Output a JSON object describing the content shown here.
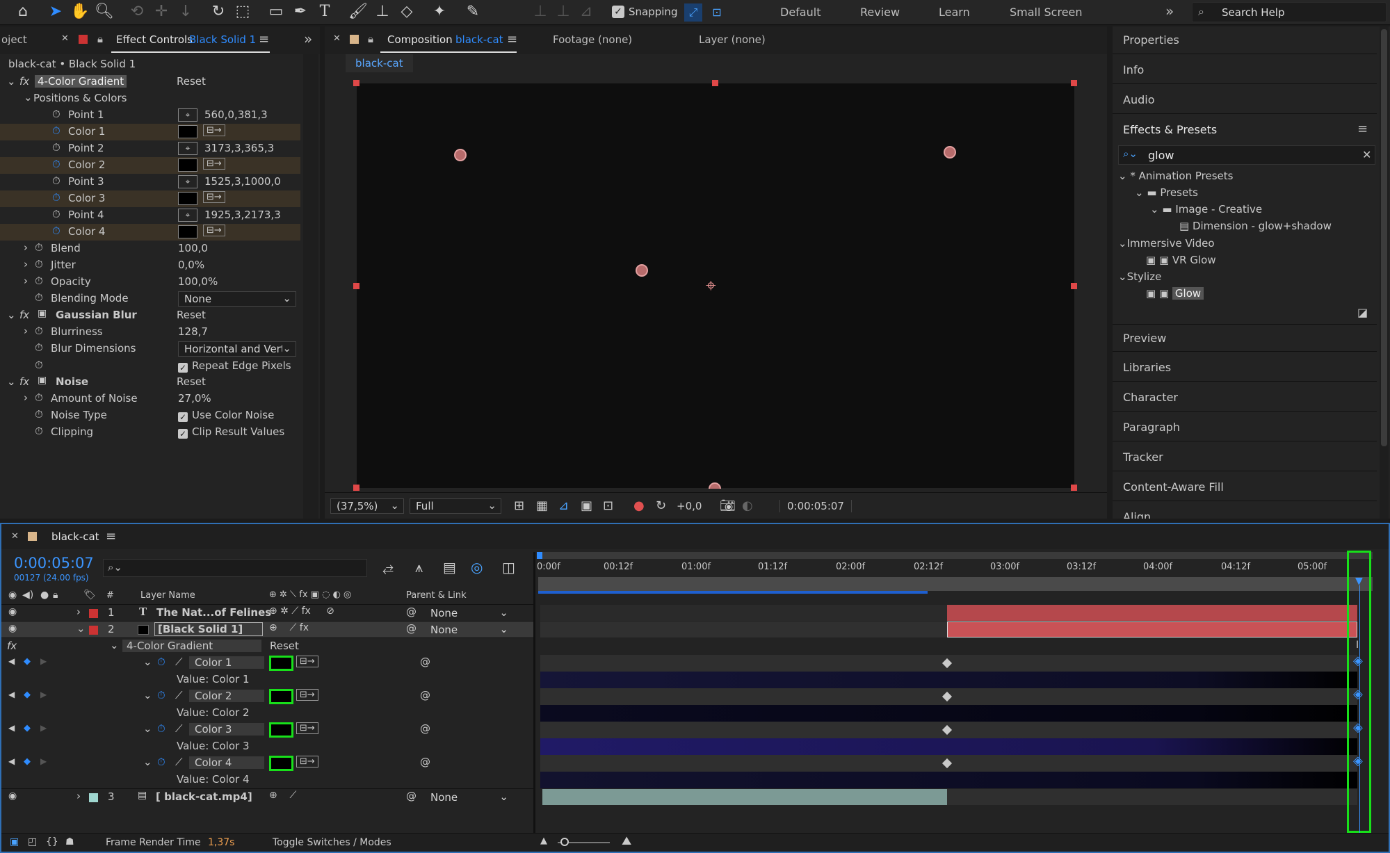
{
  "toolbar": {
    "snapping": "Snapping",
    "workspaces": [
      "Default",
      "Review",
      "Learn",
      "Small Screen"
    ],
    "search_placeholder": "Search Help"
  },
  "left_panel": {
    "tab_project": "oject",
    "tab_effect": "Effect Controls",
    "tab_effect_layer": "Black Solid 1",
    "layer_path": "black-cat • Black Solid 1",
    "rows": [
      {
        "label": "4-Color Gradient",
        "value": "Reset"
      },
      {
        "label": "Positions & Colors",
        "value": ""
      },
      {
        "label": "Point 1",
        "value": "560,0,381,3"
      },
      {
        "label": "Color 1",
        "value": ""
      },
      {
        "label": "Point 2",
        "value": "3173,3,365,3"
      },
      {
        "label": "Color 2",
        "value": ""
      },
      {
        "label": "Point 3",
        "value": "1525,3,1000,0"
      },
      {
        "label": "Color 3",
        "value": ""
      },
      {
        "label": "Point 4",
        "value": "1925,3,2173,3"
      },
      {
        "label": "Color 4",
        "value": ""
      },
      {
        "label": "Blend",
        "value": "100,0"
      },
      {
        "label": "Jitter",
        "value": "0,0%"
      },
      {
        "label": "Opacity",
        "value": "100,0%"
      },
      {
        "label": "Blending Mode",
        "value": "None"
      },
      {
        "label": "Gaussian Blur",
        "value": "Reset"
      },
      {
        "label": "Blurriness",
        "value": "128,7"
      },
      {
        "label": "Blur Dimensions",
        "value": "Horizontal and Verti"
      },
      {
        "label": "",
        "value": "Repeat Edge Pixels"
      },
      {
        "label": "Noise",
        "value": "Reset"
      },
      {
        "label": "Amount of Noise",
        "value": "27,0%"
      },
      {
        "label": "Noise Type",
        "value": "Use Color Noise"
      },
      {
        "label": "Clipping",
        "value": "Clip Result Values"
      }
    ]
  },
  "comp_panel": {
    "tab_comp": "Composition",
    "tab_comp_name": "black-cat",
    "tab_footage": "Footage (none)",
    "tab_layer": "Layer (none)",
    "subtab": "black-cat",
    "zoom": "(37,5%)",
    "resolution": "Full",
    "exposure": "+0,0",
    "timecode": "0:00:05:07"
  },
  "right_panel": {
    "properties": "Properties",
    "info": "Info",
    "audio": "Audio",
    "effects_presets": "Effects & Presets",
    "search_value": "glow",
    "tree": [
      "* Animation Presets",
      "Presets",
      "Image - Creative",
      "Dimension - glow+shadow",
      "Immersive Video",
      "VR Glow",
      "Stylize",
      "Glow"
    ],
    "sections": [
      "Preview",
      "Libraries",
      "Character",
      "Paragraph",
      "Tracker",
      "Content-Aware Fill",
      "Align"
    ]
  },
  "timeline": {
    "comp_name": "black-cat",
    "timecode": "0:00:05:07",
    "fps": "00127 (24.00 fps)",
    "col_layer_name": "Layer Name",
    "col_hash": "#",
    "col_parent": "Parent & Link",
    "ruler": [
      "0:00f",
      "00:12f",
      "01:00f",
      "01:12f",
      "02:00f",
      "02:12f",
      "03:00f",
      "03:12f",
      "04:00f",
      "04:12f",
      "05:00f"
    ],
    "layers": [
      {
        "num": "1",
        "name": "The Nat...of Felines",
        "parent": "None"
      },
      {
        "num": "2",
        "name": "[Black Solid 1]",
        "parent": "None"
      },
      {
        "num": "3",
        "name": "[ black-cat.mp4]",
        "parent": "None"
      }
    ],
    "effect_name": "4-Color Gradient",
    "effect_reset": "Reset",
    "props": [
      {
        "name": "Color 1",
        "value_label": "Value: Color 1"
      },
      {
        "name": "Color 2",
        "value_label": "Value: Color 2"
      },
      {
        "name": "Color 3",
        "value_label": "Value: Color 3"
      },
      {
        "name": "Color 4",
        "value_label": "Value: Color 4"
      }
    ],
    "footer_render_label": "Frame Render Time",
    "footer_render_value": "1,37s",
    "footer_toggle": "Toggle Switches / Modes"
  }
}
